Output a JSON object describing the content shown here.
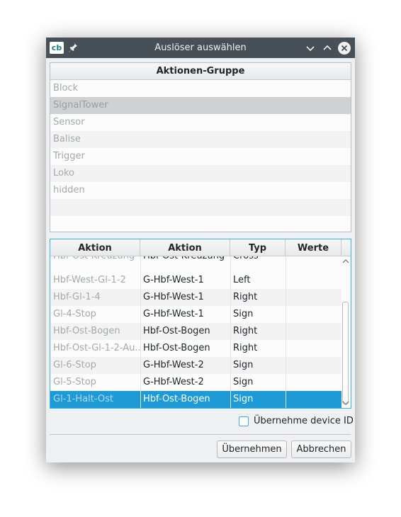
{
  "window": {
    "title": "Auslöser auswählen",
    "app_icon_text": "cb"
  },
  "top_list": {
    "header": "Aktionen-Gruppe",
    "items": [
      "Block",
      "SignalTower",
      "Sensor",
      "Balise",
      "Trigger",
      "Loko",
      "hidden"
    ],
    "selected": "SignalTower"
  },
  "bottom_table": {
    "headers": [
      "Aktion",
      "Aktion",
      "Typ",
      "Werte"
    ],
    "rows": [
      [
        "Hbf-Ost-Kreuzung",
        "Hbf-Ost-Kreuzung",
        "Cross",
        ""
      ],
      [
        "Hbf-West-Gl-1-2",
        "G-Hbf-West-1",
        "Left",
        ""
      ],
      [
        "Hbf-Gl-1-4",
        "G-Hbf-West-1",
        "Right",
        ""
      ],
      [
        "Gl-4-Stop",
        "G-Hbf-West-1",
        "Sign",
        ""
      ],
      [
        "Hbf-Ost-Bogen",
        "Hbf-Ost-Bogen",
        "Right",
        ""
      ],
      [
        "Hbf-Ost-Gl-1-2-Au...",
        "Hbf-Ost-Bogen",
        "Right",
        ""
      ],
      [
        "Gl-6-Stop",
        "G-Hbf-West-2",
        "Sign",
        ""
      ],
      [
        "Gl-5-Stop",
        "G-Hbf-West-2",
        "Sign",
        ""
      ],
      [
        "Gl-1-Halt-Ost",
        "Hbf-Ost-Bogen",
        "Sign",
        ""
      ]
    ],
    "selected_row": "Gl-1-Halt-Ost"
  },
  "checkbox": {
    "label": "Übernehme device ID",
    "checked": false
  },
  "buttons": {
    "apply": "Übernehmen",
    "cancel": "Abbrechen"
  },
  "colors": {
    "selection": "#1e9ad6",
    "focus": "#3daee9",
    "titlebar": "#475057"
  }
}
